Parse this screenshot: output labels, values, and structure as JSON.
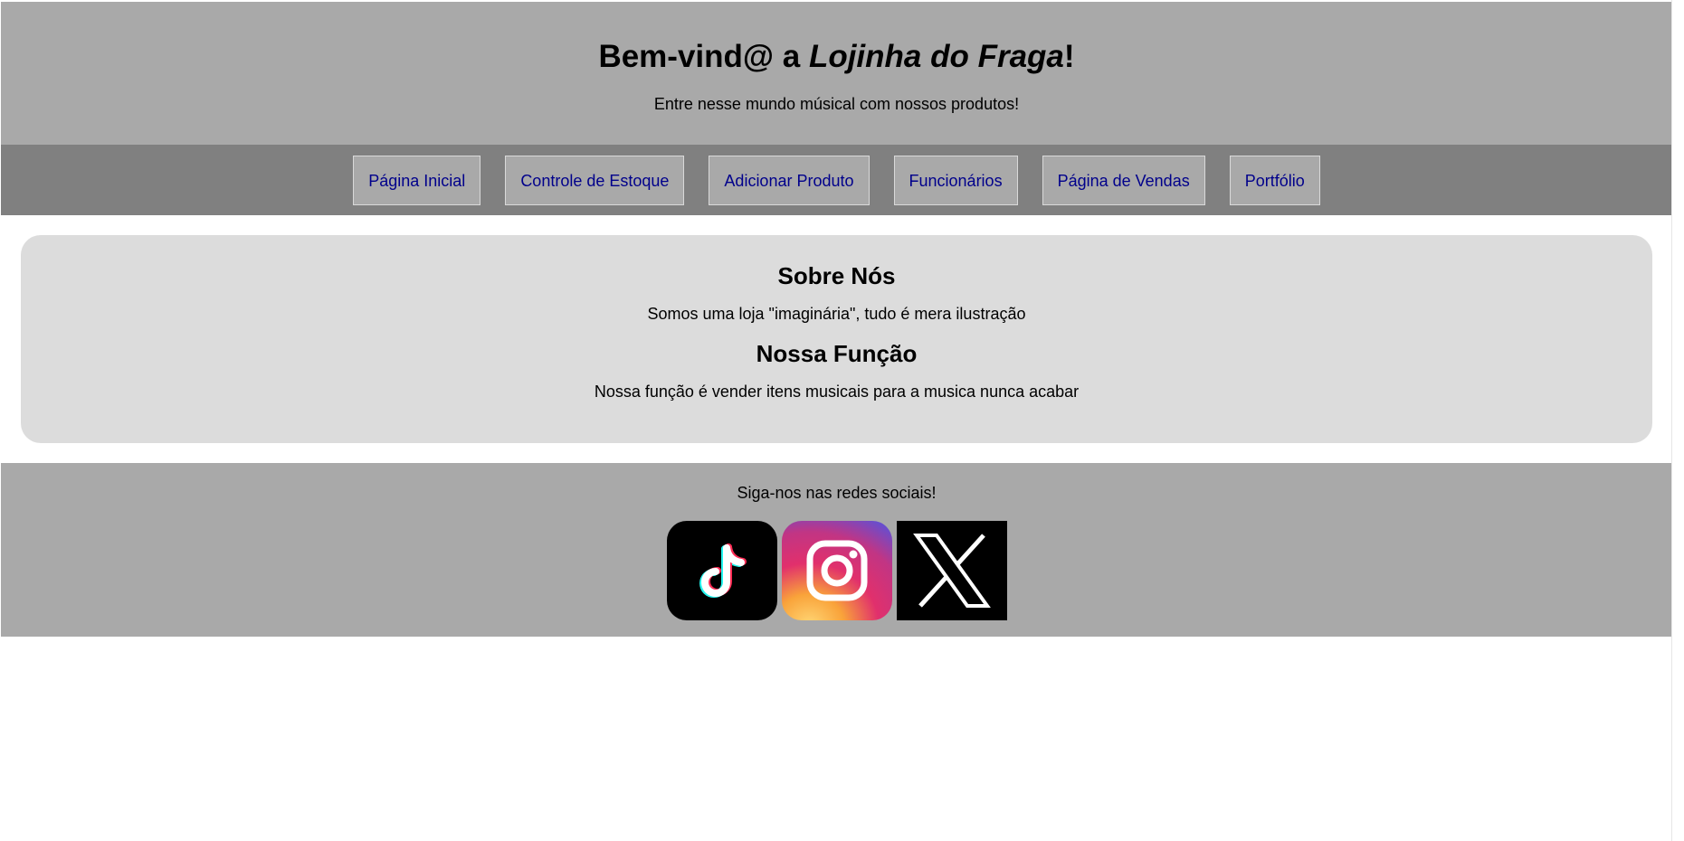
{
  "header": {
    "title_prefix": "Bem-vind@ a ",
    "title_brand": "Lojinha do Fraga",
    "title_suffix": "!",
    "subtitle": "Entre nesse mundo músical com nossos produtos!"
  },
  "nav": {
    "items": [
      {
        "label": "Página Inicial"
      },
      {
        "label": "Controle de Estoque"
      },
      {
        "label": "Adicionar Produto"
      },
      {
        "label": "Funcionários"
      },
      {
        "label": "Página de Vendas"
      },
      {
        "label": "Portfólio"
      }
    ]
  },
  "main": {
    "about_title": "Sobre Nós",
    "about_text": "Somos uma loja \"imaginária\", tudo é mera ilustração",
    "function_title": "Nossa Função",
    "function_text": "Nossa função é vender itens musicais para a musica nunca acabar"
  },
  "footer": {
    "follow_text": "Siga-nos nas redes sociais!",
    "socials": [
      {
        "icon": "tiktok-icon"
      },
      {
        "icon": "instagram-icon"
      },
      {
        "icon": "x-icon"
      }
    ]
  },
  "colors": {
    "header_bg": "#a9a9a9",
    "nav_bg": "#808080",
    "nav_link": "#00008b",
    "main_bg": "#dcdcdc",
    "footer_bg": "#a9a9a9"
  }
}
